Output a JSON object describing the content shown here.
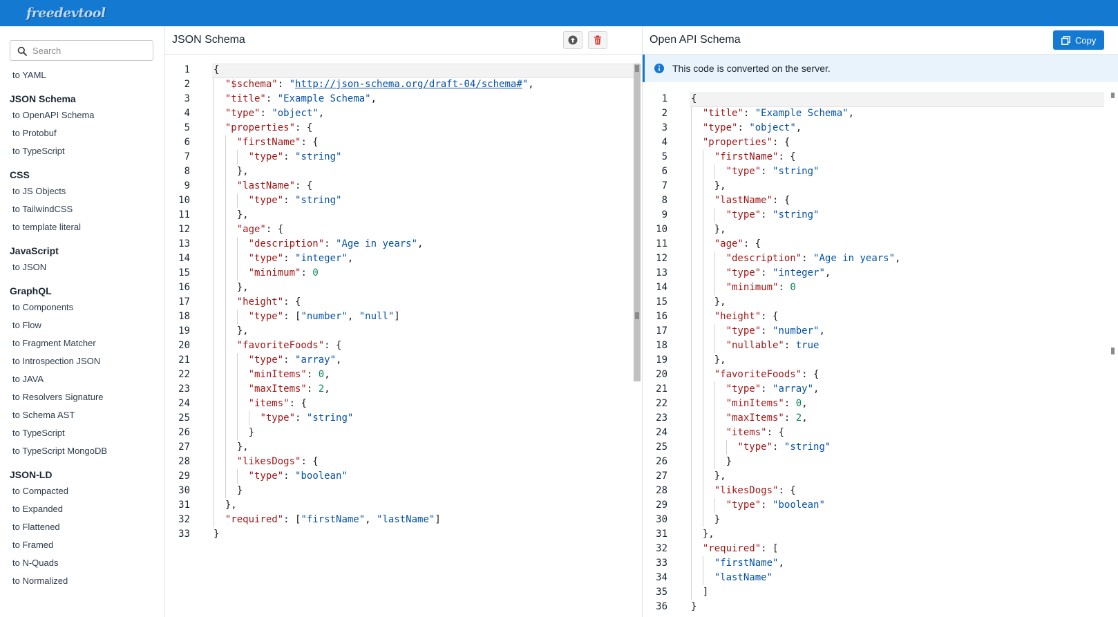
{
  "app": {
    "logo": "freedevtool"
  },
  "search": {
    "placeholder": "Search",
    "value": ""
  },
  "nav": [
    {
      "type": "item",
      "label": "to YAML"
    },
    {
      "type": "heading",
      "label": "JSON Schema"
    },
    {
      "type": "item",
      "label": "to OpenAPI Schema"
    },
    {
      "type": "item",
      "label": "to Protobuf"
    },
    {
      "type": "item",
      "label": "to TypeScript"
    },
    {
      "type": "heading",
      "label": "CSS"
    },
    {
      "type": "item",
      "label": "to JS Objects"
    },
    {
      "type": "item",
      "label": "to TailwindCSS"
    },
    {
      "type": "item",
      "label": "to template literal"
    },
    {
      "type": "heading",
      "label": "JavaScript"
    },
    {
      "type": "item",
      "label": "to JSON"
    },
    {
      "type": "heading",
      "label": "GraphQL"
    },
    {
      "type": "item",
      "label": "to Components"
    },
    {
      "type": "item",
      "label": "to Flow"
    },
    {
      "type": "item",
      "label": "to Fragment Matcher"
    },
    {
      "type": "item",
      "label": "to Introspection JSON"
    },
    {
      "type": "item",
      "label": "to JAVA"
    },
    {
      "type": "item",
      "label": "to Resolvers Signature"
    },
    {
      "type": "item",
      "label": "to Schema AST"
    },
    {
      "type": "item",
      "label": "to TypeScript"
    },
    {
      "type": "item",
      "label": "to TypeScript MongoDB"
    },
    {
      "type": "heading",
      "label": "JSON-LD"
    },
    {
      "type": "item",
      "label": "to Compacted"
    },
    {
      "type": "item",
      "label": "to Expanded"
    },
    {
      "type": "item",
      "label": "to Flattened"
    },
    {
      "type": "item",
      "label": "to Framed"
    },
    {
      "type": "item",
      "label": "to N-Quads"
    },
    {
      "type": "item",
      "label": "to Normalized"
    }
  ],
  "left_pane": {
    "title": "JSON Schema",
    "upload_icon": "upload-icon",
    "delete_icon": "trash-icon",
    "code": [
      "{",
      "  \"$schema\": \"http://json-schema.org/draft-04/schema#\",",
      "  \"title\": \"Example Schema\",",
      "  \"type\": \"object\",",
      "  \"properties\": {",
      "    \"firstName\": {",
      "      \"type\": \"string\"",
      "    },",
      "    \"lastName\": {",
      "      \"type\": \"string\"",
      "    },",
      "    \"age\": {",
      "      \"description\": \"Age in years\",",
      "      \"type\": \"integer\",",
      "      \"minimum\": 0",
      "    },",
      "    \"height\": {",
      "      \"type\": [\"number\", \"null\"]",
      "    },",
      "    \"favoriteFoods\": {",
      "      \"type\": \"array\",",
      "      \"minItems\": 0,",
      "      \"maxItems\": 2,",
      "      \"items\": {",
      "        \"type\": \"string\"",
      "      }",
      "    },",
      "    \"likesDogs\": {",
      "      \"type\": \"boolean\"",
      "    }",
      "  },",
      "  \"required\": [\"firstName\", \"lastName\"]",
      "}"
    ]
  },
  "right_pane": {
    "title": "Open API Schema",
    "copy_label": "Copy",
    "copy_icon": "copy-icon",
    "info_text": "This code is converted on the server.",
    "info_icon": "info-icon",
    "code": [
      "{",
      "  \"title\": \"Example Schema\",",
      "  \"type\": \"object\",",
      "  \"properties\": {",
      "    \"firstName\": {",
      "      \"type\": \"string\"",
      "    },",
      "    \"lastName\": {",
      "      \"type\": \"string\"",
      "    },",
      "    \"age\": {",
      "      \"description\": \"Age in years\",",
      "      \"type\": \"integer\",",
      "      \"minimum\": 0",
      "    },",
      "    \"height\": {",
      "      \"type\": \"number\",",
      "      \"nullable\": true",
      "    },",
      "    \"favoriteFoods\": {",
      "      \"type\": \"array\",",
      "      \"minItems\": 0,",
      "      \"maxItems\": 2,",
      "      \"items\": {",
      "        \"type\": \"string\"",
      "      }",
      "    },",
      "    \"likesDogs\": {",
      "      \"type\": \"boolean\"",
      "    }",
      "  },",
      "  \"required\": [",
      "    \"firstName\",",
      "    \"lastName\"",
      "  ]",
      "}"
    ]
  },
  "colors": {
    "brand": "#1479d1",
    "key": "#a31515",
    "string": "#0451a5",
    "number": "#098658",
    "info_bg": "#e8f3fb"
  }
}
